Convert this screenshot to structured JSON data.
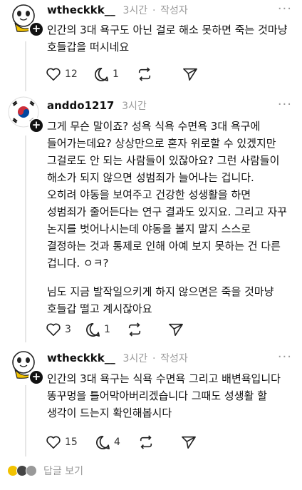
{
  "posts": [
    {
      "username": "wtheckkk__",
      "time": "3시간",
      "author_tag": "작성자",
      "lines": [
        "인간의 3대 욕구도 아닌 걸로 해소 못하면 죽는 것마냥",
        "호들갑을 떠시네요"
      ],
      "likes": "12",
      "replies": "1",
      "reposts": "",
      "shares": ""
    },
    {
      "username": "anddo1217",
      "time": "3시간",
      "author_tag": "",
      "lines": [
        "그게 무슨 말이죠? 성욕 식욕 수면욕 3대 욕구에",
        "들어가는데요? 상상만으로 혼자 위로할 수 있겠지만",
        "그걸로도 안 되는 사람들이 있잖아요? 그런 사람들이",
        "해소가 되지 않으면 성범죄가 늘어나는 겁니다.",
        "오히려 야동을 보여주고 건강한 성생활을 하면",
        "성범죄가 줄어든다는 연구 결과도 있지요. 그리고 자꾸",
        "논지를 벗어나시는데 야동을 볼지 말지 스스로",
        "결정하는 것과 통제로 인해 아예 보지 못하는 건 다른",
        "겁니다. ㅇㅋ?",
        "",
        "님도 지금 발작일으키게 하지 않으면은 죽을 것마냥",
        "호들갑 떨고  계시잖아요"
      ],
      "likes": "3",
      "replies": "1",
      "reposts": "",
      "shares": ""
    },
    {
      "username": "wtheckkk__",
      "time": "3시간",
      "author_tag": "작성자",
      "lines": [
        "인간의 3대 욕구는 식욕 수면욕 그리고 배변욕입니다",
        "똥꾸멍을 틀어막아버리겠습니다 그때도 성생활 할",
        "생각이 드는지 확인해봅시다"
      ],
      "likes": "15",
      "replies": "4",
      "reposts": "",
      "shares": ""
    }
  ],
  "footer": {
    "view_replies": "답글 보기"
  },
  "icons": {
    "like": "heart-icon",
    "reply": "comment-bubble-icon",
    "repost": "repost-arrows-icon",
    "share": "paper-plane-icon",
    "more": "more-dots-icon",
    "follow": "plus-icon"
  },
  "colors": {
    "text": "#111111",
    "muted": "#9a9a9a",
    "duck_yellow": "#f2c200",
    "korea_red": "#cd2e3a",
    "korea_blue": "#0047a0"
  }
}
